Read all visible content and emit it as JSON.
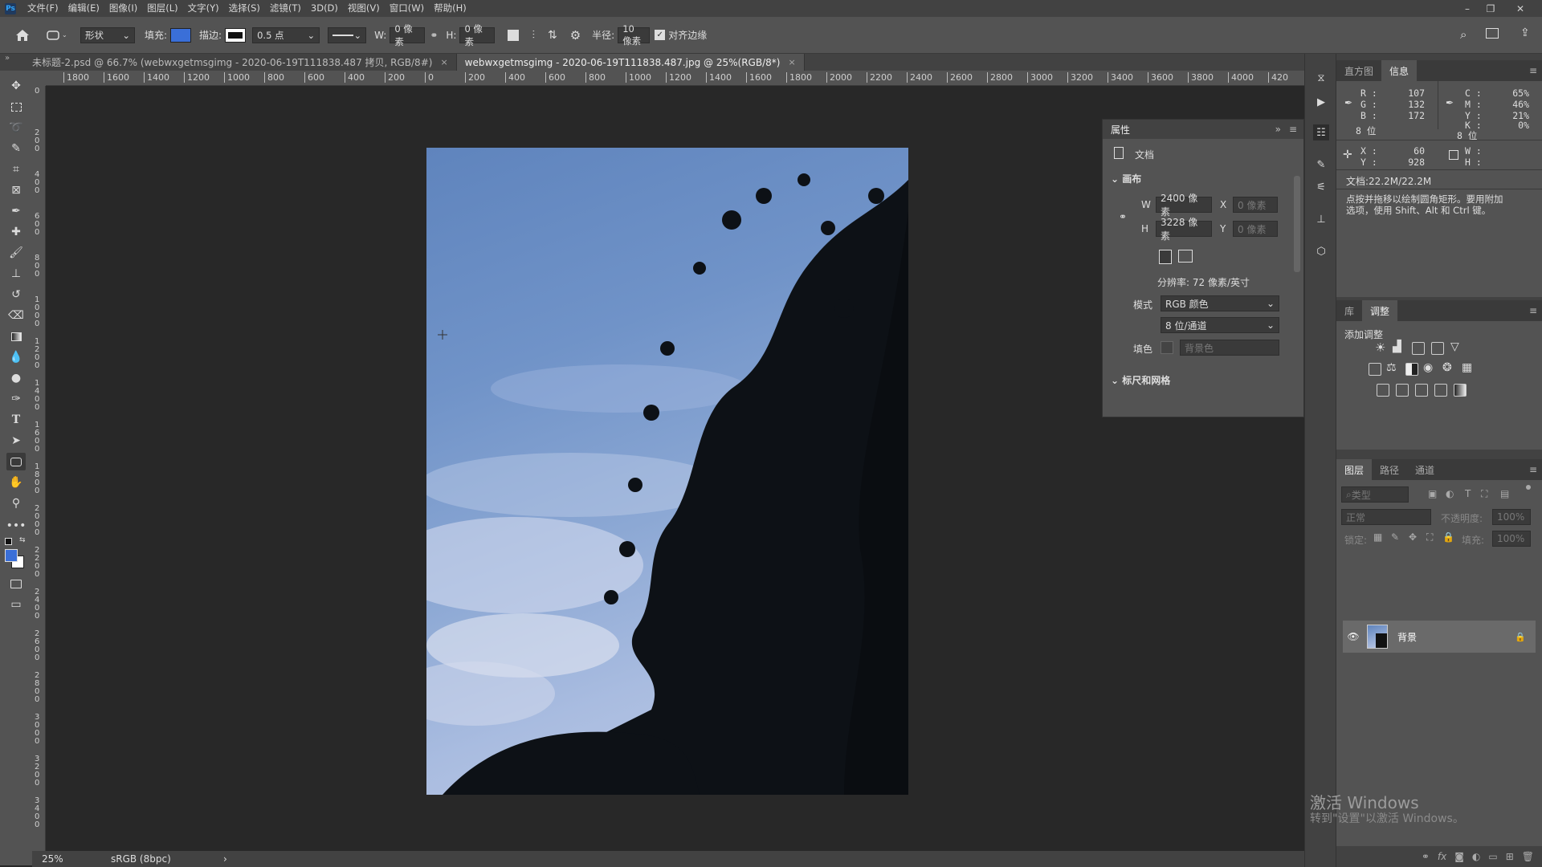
{
  "menubar": {
    "logo": "Ps",
    "items": [
      "文件(F)",
      "编辑(E)",
      "图像(I)",
      "图层(L)",
      "文字(Y)",
      "选择(S)",
      "滤镜(T)",
      "3D(D)",
      "视图(V)",
      "窗口(W)",
      "帮助(H)"
    ],
    "minimize": "–",
    "restore": "❐",
    "close": "✕"
  },
  "options": {
    "shape_mode": "形状",
    "fill_label": "填充:",
    "stroke_label": "描边:",
    "stroke_width": "0.5 点",
    "w_label": "W:",
    "w_value": "0 像素",
    "h_label": "H:",
    "h_value": "0 像素",
    "radius_label": "半径:",
    "radius_value": "10 像素",
    "align_edges_label": "对齐边缘",
    "fill_color": "#3a6fd8"
  },
  "tabs": [
    {
      "label": "未标题-2.psd @ 66.7% (webwxgetmsgimg - 2020-06-19T111838.487 拷贝, RGB/8#)",
      "close": "×"
    },
    {
      "label": "webwxgetmsgimg - 2020-06-19T111838.487.jpg @ 25%(RGB/8*)",
      "close": "×"
    }
  ],
  "ruler": {
    "h_labels": [
      "1800",
      "1600",
      "1400",
      "1200",
      "1000",
      "800",
      "600",
      "400",
      "200",
      "0",
      "200",
      "400",
      "600",
      "800",
      "1000",
      "1200",
      "1400",
      "1600",
      "1800",
      "2000",
      "2200",
      "2400",
      "2600",
      "2800",
      "3000",
      "3200",
      "3400",
      "3600",
      "3800",
      "4000",
      "420"
    ],
    "v_labels": [
      "0",
      "200",
      "400",
      "600",
      "800",
      "1000",
      "1200",
      "1400",
      "1600",
      "1800",
      "2000",
      "2200",
      "2400",
      "2600",
      "2800",
      "3000",
      "3200",
      "3400"
    ]
  },
  "status": {
    "zoom": "25%",
    "profile": "sRGB (8bpc)",
    "arrow": "›"
  },
  "properties": {
    "title": "属性",
    "doc_label": "文档",
    "canvas_section": "画布",
    "w_label": "W",
    "w_value": "2400 像素",
    "x_label": "X",
    "x_placeholder": "0 像素",
    "h_label": "H",
    "h_value": "3228 像素",
    "y_label": "Y",
    "y_placeholder": "0 像素",
    "resolution": "分辨率: 72 像素/英寸",
    "mode_label": "模式",
    "mode_value": "RGB 颜色",
    "depth_value": "8 位/通道",
    "fill_label": "填色",
    "fill_placeholder": "背景色",
    "rulers_section": "标尺和网格"
  },
  "info_panel": {
    "tabs": [
      "直方图",
      "信息"
    ],
    "r_label": "R :",
    "r_value": "107",
    "g_label": "G :",
    "g_value": "132",
    "b_label": "B :",
    "b_value": "172",
    "bit_left": "8 位",
    "c_label": "C :",
    "c_value": "65%",
    "m_label": "M :",
    "m_value": "46%",
    "y_label": "Y :",
    "y_value": "21%",
    "k_label": "K :",
    "k_value": "0%",
    "bit_right": "8 位",
    "x_label": "X :",
    "x_value": "60",
    "yy_label": "Y :",
    "yy_value": "928",
    "w_label": "W :",
    "h_label": "H :",
    "doc_size": "文档:22.2M/22.2M",
    "hint": "点按并拖移以绘制圆角矩形。要用附加选项，使用 Shift、Alt 和 Ctrl 键。"
  },
  "adjust_panel": {
    "tabs": [
      "库",
      "调整"
    ],
    "add_label": "添加调整"
  },
  "layers_panel": {
    "tabs": [
      "图层",
      "路径",
      "通道"
    ],
    "search_placeholder": "类型",
    "blend_mode": "正常",
    "opacity_label": "不透明度:",
    "opacity_value": "100%",
    "lock_label": "锁定:",
    "fill_label": "填充:",
    "fill_value": "100%",
    "layer_name": "背景"
  },
  "watermark": {
    "line1": "激活 Windows",
    "line2": "转到\"设置\"以激活 Windows。"
  }
}
